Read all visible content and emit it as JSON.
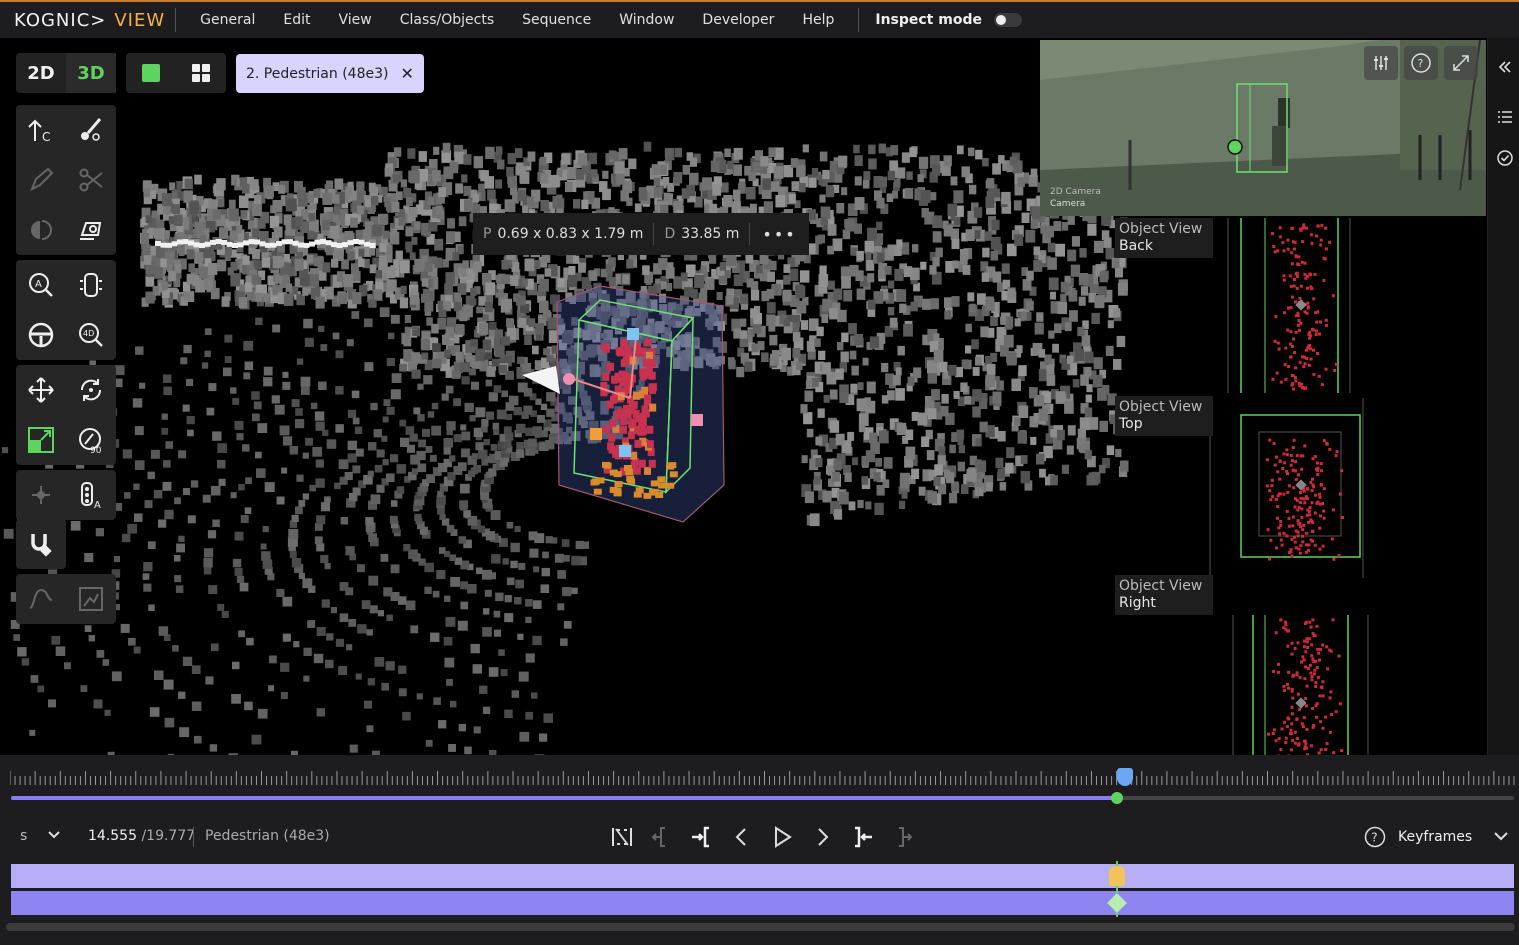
{
  "menubar": {
    "brand": "KOGNIC>",
    "product": "VIEW",
    "items": [
      "General",
      "Edit",
      "View",
      "Class/Objects",
      "Sequence",
      "Window",
      "Developer",
      "Help"
    ],
    "inspect_label": "Inspect mode",
    "inspect_on": false
  },
  "toolbar": {
    "mode_2d": "2D",
    "mode_3d": "3D",
    "active_mode": "3D",
    "object_tab": "2. Pedestrian (48e3)"
  },
  "dimensions": {
    "p_label": "P",
    "p_value": "0.69 x 0.83 x 1.79 m",
    "d_label": "D",
    "d_value": "33.85 m",
    "more": "•••"
  },
  "camera": {
    "title": "2D Camera",
    "name": "Camera"
  },
  "object_views": [
    {
      "title": "Object View",
      "name": "Back"
    },
    {
      "title": "Object View",
      "name": "Top"
    },
    {
      "title": "Object View",
      "name": "Right"
    }
  ],
  "timeline": {
    "step_unit": "s",
    "current_time": "14.555",
    "total_time": "/19.777",
    "object": "Pedestrian (48e3)",
    "progress": 0.736,
    "keyframes_label": "Keyframes"
  },
  "colors": {
    "accent_green": "#5fd35f",
    "brand_orange": "#f4b04a",
    "object_tab_bg": "#d9d3ff",
    "lane_light": "#b7aef8",
    "lane_dark": "#8f85f2"
  }
}
